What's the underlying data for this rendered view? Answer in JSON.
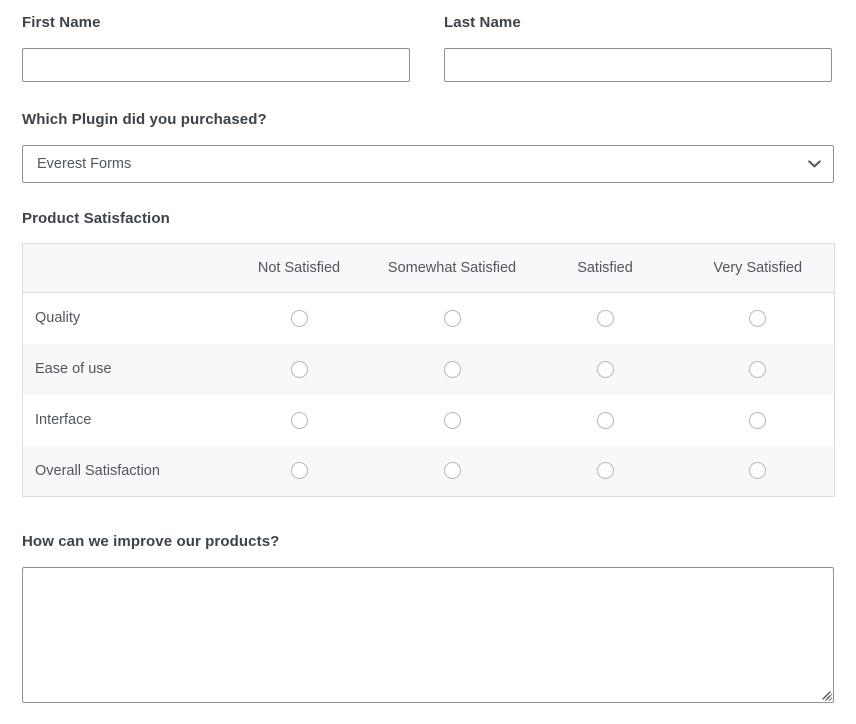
{
  "form": {
    "fields": {
      "first_name": {
        "label": "First Name",
        "value": "",
        "placeholder": ""
      },
      "last_name": {
        "label": "Last Name",
        "value": "",
        "placeholder": ""
      },
      "plugin": {
        "label": "Which Plugin did you purchased?",
        "selected": "Everest Forms",
        "options": [
          "Everest Forms"
        ],
        "icon": "chevron-down-icon"
      },
      "satisfaction": {
        "label": "Product Satisfaction",
        "corner_header": "",
        "columns": [
          "Not Satisfied",
          "Somewhat Satisfied",
          "Satisfied",
          "Very Satisfied"
        ],
        "rows": [
          {
            "label": "Quality",
            "selected": null
          },
          {
            "label": "Ease of use",
            "selected": null
          },
          {
            "label": "Interface",
            "selected": null
          },
          {
            "label": "Overall Satisfaction",
            "selected": null
          }
        ]
      },
      "improve": {
        "label": "How can we improve our products?",
        "value": "",
        "placeholder": "",
        "icon": "resize-handle-icon"
      }
    }
  },
  "colors": {
    "page_background": "#ffffff",
    "label_text": "#3c434a",
    "body_text": "#50575e",
    "input_border": "#8c9196",
    "table_border": "#dcdcde",
    "stripe_background": "#f7f8f9",
    "radio_border": "#b4b9bf"
  }
}
